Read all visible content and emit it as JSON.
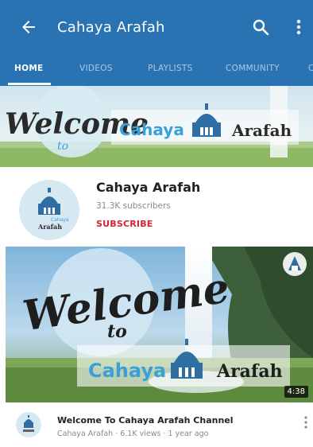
{
  "colors": {
    "appbar": "#2a73b3",
    "subscribe": "#d4252f",
    "banner_script": "#2a2a2a",
    "banner_accent": "#3aa0d8"
  },
  "appbar": {
    "title": "Cahaya Arafah",
    "back_icon": "arrow-left-icon",
    "search_icon": "search-icon",
    "more_icon": "more-vert-icon"
  },
  "tabs": [
    {
      "label": "HOME",
      "active": true
    },
    {
      "label": "VIDEOS",
      "active": false
    },
    {
      "label": "PLAYLISTS",
      "active": false
    },
    {
      "label": "COMMUNITY",
      "active": false
    }
  ],
  "banner": {
    "welcome": "Welcome",
    "to": "to",
    "name_left": "Cahaya",
    "name_right": "Arafah"
  },
  "channel": {
    "name": "Cahaya Arafah",
    "subscribers": "31.3K subscribers",
    "subscribe_label": "SUBSCRIBE",
    "avatar_text_top": "Cahaya",
    "avatar_text_bottom": "Arafah"
  },
  "video": {
    "thumb_welcome": "Welcome",
    "thumb_to": "to",
    "thumb_name_left": "Cahaya",
    "thumb_name_right": "Arafah",
    "duration": "4:38",
    "title": "Welcome To Cahaya Arafah Channel",
    "meta": "Cahaya Arafah · 6.1K views · 1 year ago"
  }
}
